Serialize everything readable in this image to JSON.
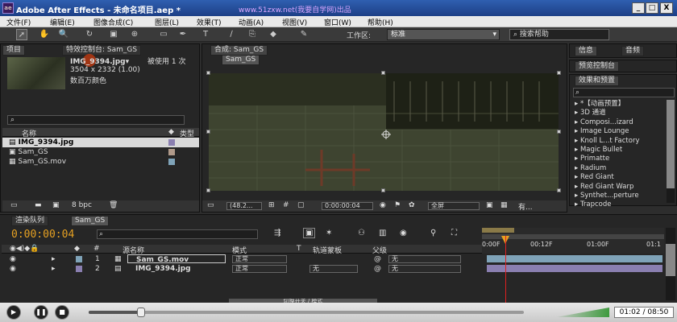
{
  "window": {
    "logo": "ae",
    "title": "Adobe After Effects - 未命名项目.aep *",
    "watermark": "www.51zxw.net(我要自学网)出品",
    "min": "_",
    "max": "□",
    "close": "X"
  },
  "menu": [
    "文件(F)",
    "编辑(E)",
    "图像合成(C)",
    "图层(L)",
    "效果(T)",
    "动画(A)",
    "视图(V)",
    "窗口(W)",
    "帮助(H)"
  ],
  "toolbar": {
    "workspace_label": "工作区:",
    "workspace_value": "标准",
    "search_placeholder": "搜索帮助"
  },
  "project": {
    "tab_project": "项目",
    "tab_effects": "特效控制台: Sam_GS",
    "item_name": "IMG_9394.jpg▾",
    "used": "被使用 1 次",
    "dims": "3504 x 2332 (1.00)",
    "colors": "数百万颜色",
    "col_name": "名称",
    "col_type": "类型",
    "items": [
      "IMG_9394.jpg",
      "Sam_GS",
      "Sam_GS.mov"
    ],
    "bpc": "8 bpc"
  },
  "comp": {
    "tab": "合成: Sam_GS",
    "subtab": "Sam_GS",
    "zoom": "(48.2...",
    "time": "0:00:00:04",
    "view": "全屏",
    "extra": "有..."
  },
  "right": {
    "tab_info": "信息",
    "tab_audio": "音频",
    "tab_preview": "预览控制台",
    "tab_effects": "效果和预置",
    "effects": [
      "*【动画预置】",
      "3D 通道",
      "Composi...izard",
      "Image Lounge",
      "Knoll L...t Factory",
      "Magic Bullet",
      "Primatte",
      "Radium",
      "Red Giant",
      "Red Giant Warp",
      "Synthet...perture",
      "Trapcode"
    ]
  },
  "timeline": {
    "tab_render": "渲染队列",
    "tab_comp": "Sam_GS",
    "timecode": "0:00:00:04",
    "col_layer": "源名称",
    "col_mode": "模式",
    "col_t": "T",
    "col_track": "轨道蒙板",
    "col_parent": "父级",
    "layers": [
      {
        "num": "1",
        "name": "Sam_GS.mov",
        "mode": "正常",
        "track": "",
        "parent": "无"
      },
      {
        "num": "2",
        "name": "IMG_9394.jpg",
        "mode": "正常",
        "track": "无",
        "parent": "无"
      }
    ],
    "ruler": [
      "0:00F",
      "00:12F",
      "01:00F",
      "01:1"
    ],
    "toggle": "切换开关 / 模式"
  },
  "player": {
    "time": "01:02 / 08:50",
    "progress": 0.12
  }
}
